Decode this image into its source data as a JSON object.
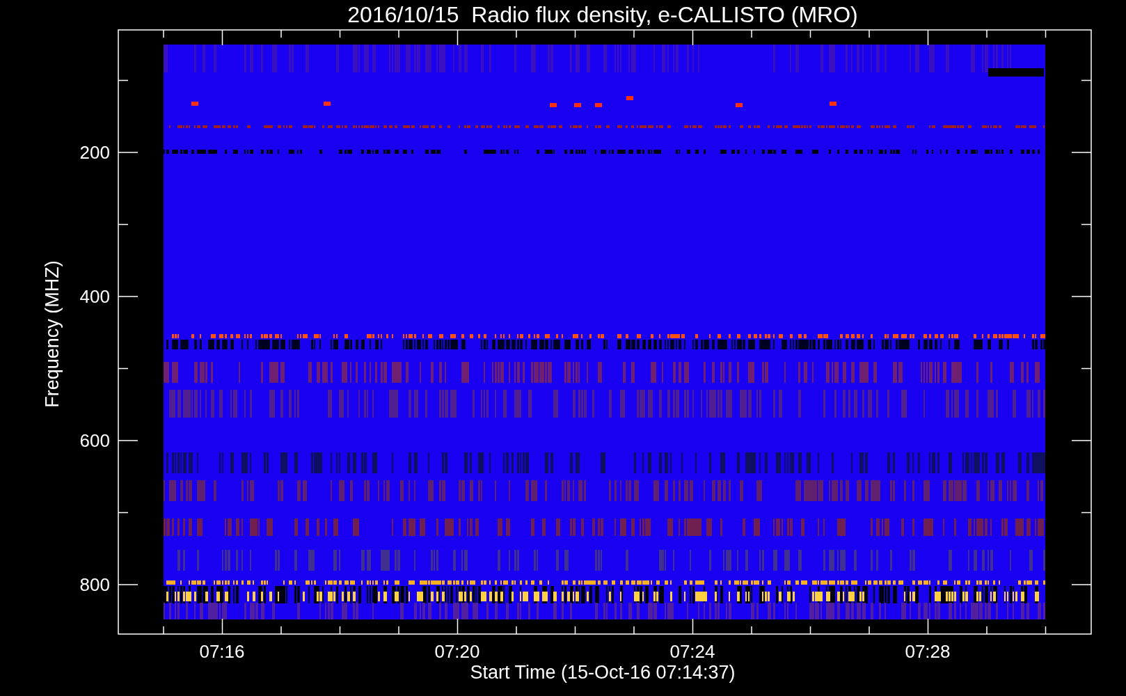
{
  "chart": {
    "title": "2016/10/15  Radio flux density, e-CALLISTO (MRO)",
    "ylabel": "Frequency (MHZ)",
    "xlabel": "Start Time (15-Oct-16 07:14:37)",
    "y_tick_labels": [
      "200",
      "400",
      "600",
      "800"
    ],
    "x_tick_labels": [
      "07:16",
      "07:20",
      "07:24",
      "07:28"
    ]
  }
}
